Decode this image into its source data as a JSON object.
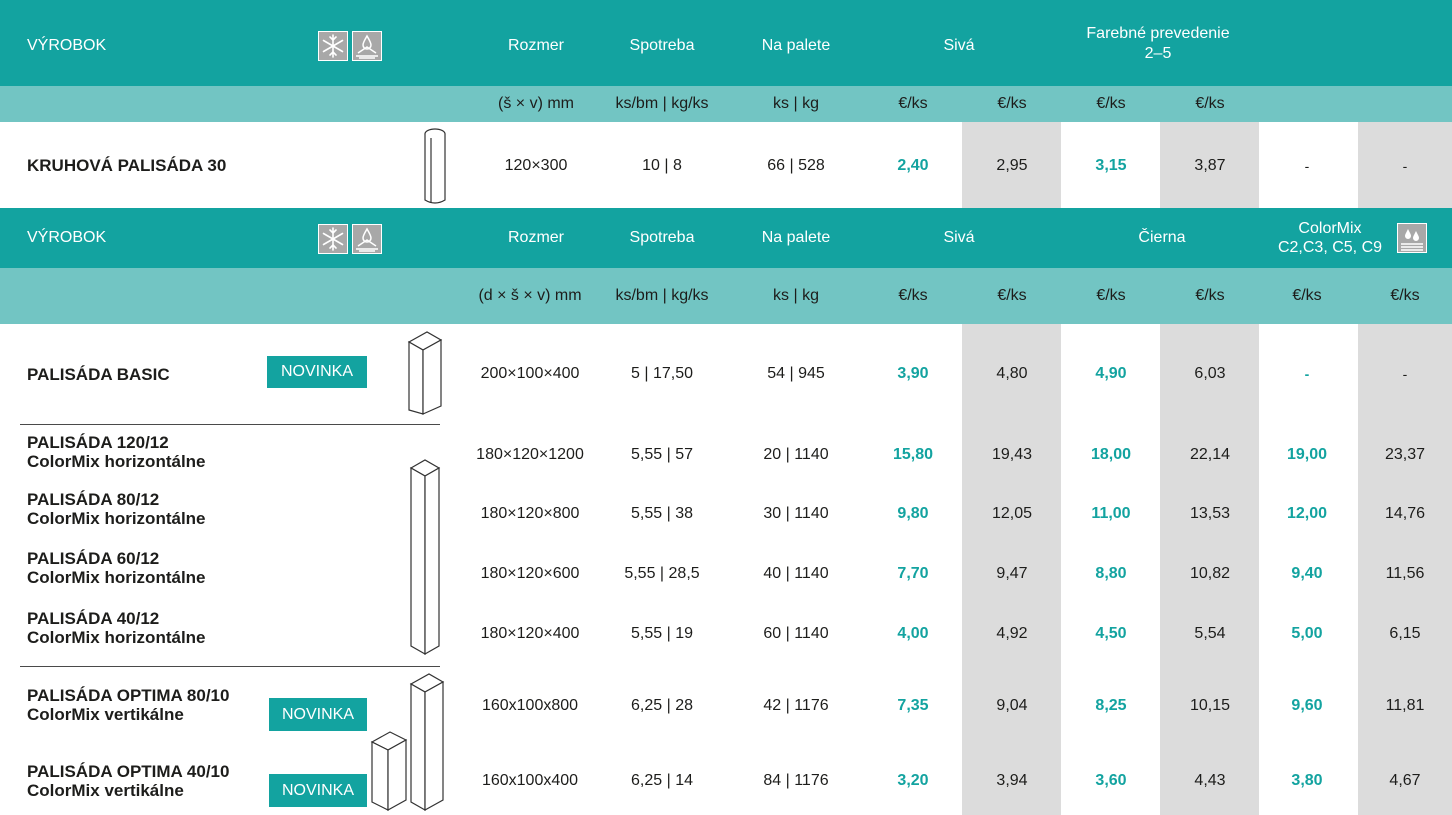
{
  "colors": {
    "accent": "#13a3a0",
    "header_bg": "#13a3a0",
    "subheader_bg": "#72c5c3",
    "shaded_col": "#dcdcdc"
  },
  "table1": {
    "header": {
      "product": "VÝROBOK",
      "icons": [
        "snowflake-icon",
        "water-drop-icon"
      ],
      "size": "Rozmer",
      "consumption": "Spotreba",
      "pallet": "Na palete",
      "grey": "Sivá",
      "color_line1": "Farebné prevedenie",
      "color_line2": "2–5"
    },
    "subheader": {
      "size_unit": "(š × v) mm",
      "consumption_unit": "ks/bm | kg/ks",
      "pallet_unit": "ks | kg",
      "price_units": [
        "€/ks",
        "€/ks",
        "€/ks",
        "€/ks"
      ]
    },
    "rows": [
      {
        "name": "KRUHOVÁ PALISÁDA 30",
        "size": "120×300",
        "consumption": "10 | 8",
        "pallet": "66 | 528",
        "prices": [
          "2,40",
          "2,95",
          "3,15",
          "3,87",
          "-",
          "-"
        ]
      }
    ]
  },
  "table2": {
    "header": {
      "product": "VÝROBOK",
      "icons": [
        "snowflake-icon",
        "water-drop-icon",
        "water-drops-icon"
      ],
      "size": "Rozmer",
      "consumption": "Spotreba",
      "pallet": "Na palete",
      "grey": "Sivá",
      "black": "Čierna",
      "colormix_line1": "ColorMix",
      "colormix_line2": "C2,C3, C5, C9"
    },
    "subheader": {
      "size_unit": "(d × š × v) mm",
      "consumption_unit": "ks/bm | kg/ks",
      "pallet_unit": "ks | kg",
      "price_units": [
        "€/ks",
        "€/ks",
        "€/ks",
        "€/ks",
        "€/ks",
        "€/ks"
      ]
    },
    "rows": [
      {
        "name1": "PALISÁDA BASIC",
        "name2": "",
        "badge": "NOVINKA",
        "size": "200×100×400",
        "consumption": "5 | 17,50",
        "pallet": "54 | 945",
        "prices": [
          "3,90",
          "4,80",
          "4,90",
          "6,03",
          "-",
          "-"
        ]
      },
      {
        "name1": "PALISÁDA 120/12",
        "name2": "ColorMix  horizontálne",
        "size": "180×120×1200",
        "consumption": "5,55 | 57",
        "pallet": "20 | 1140",
        "prices": [
          "15,80",
          "19,43",
          "18,00",
          "22,14",
          "19,00",
          "23,37"
        ]
      },
      {
        "name1": "PALISÁDA 80/12",
        "name2": "ColorMix  horizontálne",
        "size": "180×120×800",
        "consumption": "5,55 | 38",
        "pallet": "30 | 1140",
        "prices": [
          "9,80",
          "12,05",
          "11,00",
          "13,53",
          "12,00",
          "14,76"
        ]
      },
      {
        "name1": "PALISÁDA 60/12",
        "name2": "ColorMix  horizontálne",
        "size": "180×120×600",
        "consumption": "5,55 | 28,5",
        "pallet": "40 | 1140",
        "prices": [
          "7,70",
          "9,47",
          "8,80",
          "10,82",
          "9,40",
          "11,56"
        ]
      },
      {
        "name1": "PALISÁDA 40/12",
        "name2": "ColorMix  horizontálne",
        "size": "180×120×400",
        "consumption": "5,55 | 19",
        "pallet": "60 | 1140",
        "prices": [
          "4,00",
          "4,92",
          "4,50",
          "5,54",
          "5,00",
          "6,15"
        ]
      },
      {
        "name1": "PALISÁDA OPTIMA 80/10",
        "name2": "ColorMix vertikálne",
        "badge": "NOVINKA",
        "size": "160x100x800",
        "consumption": "6,25 | 28",
        "pallet": "42 | 1176",
        "prices": [
          "7,35",
          "9,04",
          "8,25",
          "10,15",
          "9,60",
          "11,81"
        ]
      },
      {
        "name1": "PALISÁDA OPTIMA 40/10",
        "name2": "ColorMix vertikálne",
        "badge": "NOVINKA",
        "size": "160x100x400",
        "consumption": "6,25 | 14",
        "pallet": "84 | 1176",
        "prices": [
          "3,20",
          "3,94",
          "3,60",
          "4,43",
          "3,80",
          "4,67"
        ]
      }
    ]
  }
}
